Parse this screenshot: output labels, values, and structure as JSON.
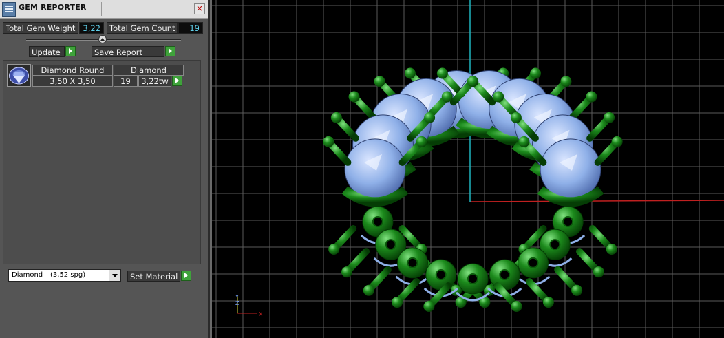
{
  "panel": {
    "title": "GEM REPORTER",
    "close_glyph": "×",
    "total_weight_label": "Total Gem Weight",
    "total_weight_value": "3,22",
    "total_count_label": "Total Gem Count",
    "total_count_value": "19",
    "update_label": "Update",
    "save_report_label": "Save Report"
  },
  "gem_list": [
    {
      "thumbnail_icon": "round-diamond-icon",
      "shape_label": "Diamond Round",
      "material_label": "Diamond",
      "size": "3,50 X 3,50",
      "count": "19",
      "weight": "3,22tw"
    }
  ],
  "material": {
    "name": "Diamond",
    "spg": "(3,52 spg)",
    "set_material_label": "Set Material"
  },
  "viewport": {
    "axis_y_label": "Y",
    "axis_z_label": "Z",
    "axis_x_label": "X",
    "colors": {
      "background": "#000000",
      "grid": "#5a5a5a",
      "axis_x": "#c02020",
      "axis_y": "#1fb5c0",
      "gem": "#8fb0e8",
      "metal": "#1c8a1c"
    }
  }
}
